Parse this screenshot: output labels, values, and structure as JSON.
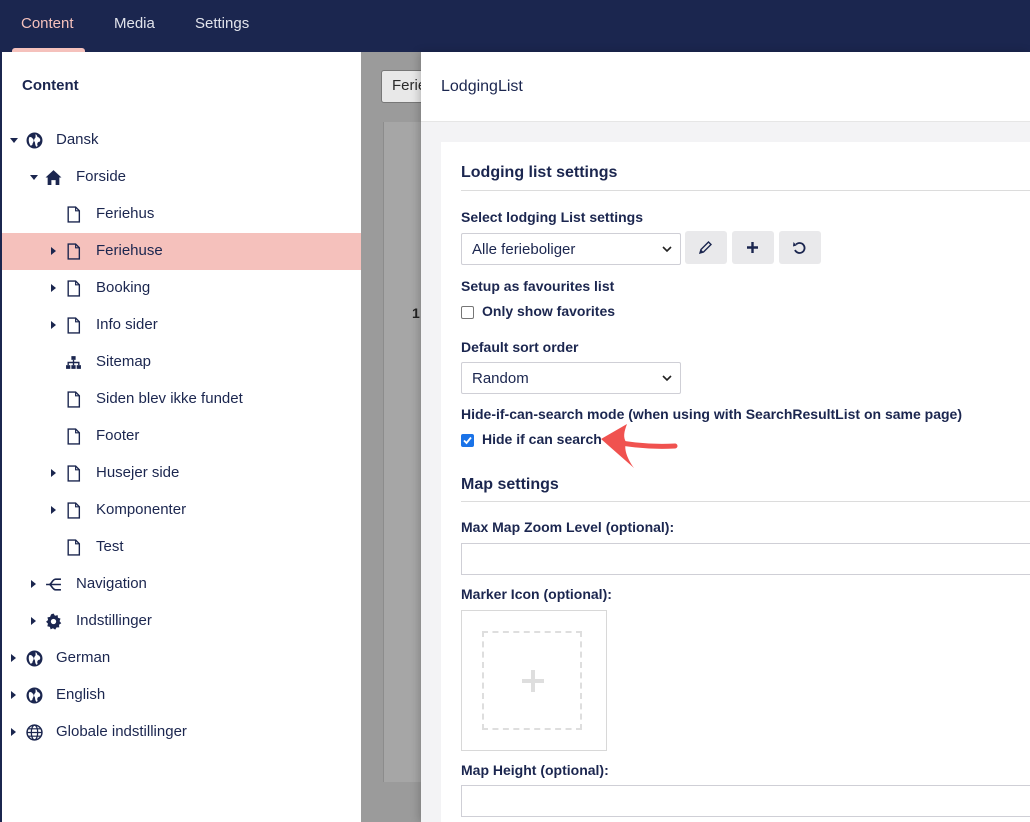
{
  "topnav": {
    "items": [
      {
        "label": "Content",
        "active": true
      },
      {
        "label": "Media",
        "active": false
      },
      {
        "label": "Settings",
        "active": false
      }
    ]
  },
  "sidebar": {
    "title": "Content",
    "tree": [
      {
        "label": "Dansk",
        "icon": "globe-icon",
        "caret": "down"
      },
      {
        "label": "Forside",
        "icon": "home-icon",
        "caret": "down"
      },
      {
        "label": "Feriehus",
        "icon": "document-icon",
        "caret": ""
      },
      {
        "label": "Feriehuse",
        "icon": "document-icon",
        "caret": "right",
        "active": true
      },
      {
        "label": "Booking",
        "icon": "document-icon",
        "caret": "right"
      },
      {
        "label": "Info sider",
        "icon": "document-icon",
        "caret": "right"
      },
      {
        "label": "Sitemap",
        "icon": "sitemap-icon",
        "caret": ""
      },
      {
        "label": "Siden blev ikke fundet",
        "icon": "document-icon",
        "caret": ""
      },
      {
        "label": "Footer",
        "icon": "document-icon",
        "caret": ""
      },
      {
        "label": "Husejer side",
        "icon": "document-icon",
        "caret": "right"
      },
      {
        "label": "Komponenter",
        "icon": "document-icon",
        "caret": "right"
      },
      {
        "label": "Test",
        "icon": "document-icon",
        "caret": ""
      },
      {
        "label": "Navigation",
        "icon": "navigation-icon",
        "caret": "right"
      },
      {
        "label": "Indstillinger",
        "icon": "gear-icon",
        "caret": "right"
      },
      {
        "label": "German",
        "icon": "globe-icon",
        "caret": "right"
      },
      {
        "label": "English",
        "icon": "globe-icon",
        "caret": "right"
      },
      {
        "label": "Globale indstillinger",
        "icon": "world-grid-icon",
        "caret": "right"
      }
    ]
  },
  "background": {
    "input_text": "Ferie",
    "number_text": "1"
  },
  "panel": {
    "title": "LodgingList",
    "lodging_section": {
      "title": "Lodging list settings",
      "select_settings_label": "Select lodging List settings",
      "select_settings_value": "Alle ferieboliger",
      "edit_button_icon": "pencil-icon",
      "add_button_icon": "plus-icon",
      "reset_button_icon": "undo-icon",
      "favourites_label": "Setup as favourites list",
      "only_favorites_label": "Only show favorites",
      "only_favorites_checked": false,
      "sort_label": "Default sort order",
      "sort_value": "Random",
      "hide_mode_label": "Hide-if-can-search mode (when using with SearchResultList on same page)",
      "hide_if_search_label": "Hide if can search",
      "hide_if_search_checked": true
    },
    "map_section": {
      "title": "Map settings",
      "zoom_label": "Max Map Zoom Level (optional):",
      "zoom_value": "",
      "marker_label": "Marker Icon (optional):",
      "height_label": "Map Height (optional):",
      "height_value": ""
    }
  },
  "colors": {
    "topbar": "#1b264f",
    "accent": "#f5c1bc",
    "checkbox": "#1a73e8",
    "annotation_arrow": "#f0524f"
  }
}
